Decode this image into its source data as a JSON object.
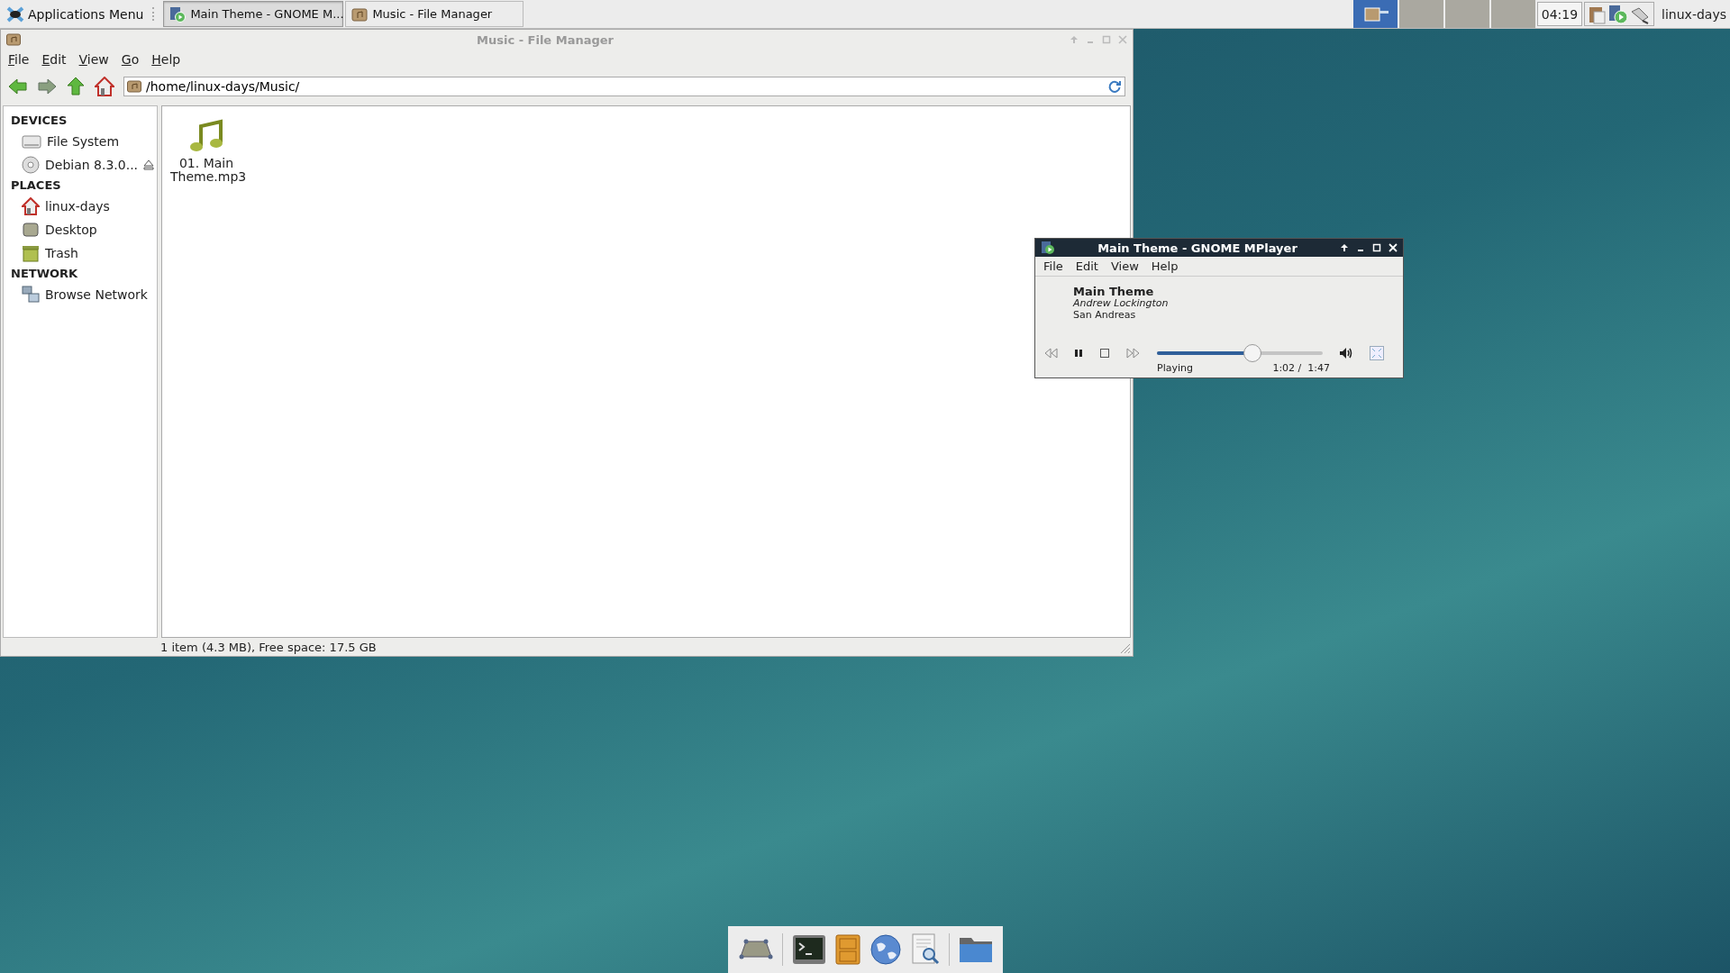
{
  "panel": {
    "apps_menu": "Applications Menu",
    "tasks": [
      {
        "label": "Main Theme - GNOME M...",
        "kind": "player",
        "selected": true
      },
      {
        "label": "Music - File Manager",
        "kind": "folder",
        "selected": false
      }
    ],
    "workspaces": [
      {
        "selected": true
      },
      {
        "selected": false
      },
      {
        "selected": false
      },
      {
        "selected": false
      }
    ],
    "clock": "04:19",
    "tray": [
      {
        "kind": "clipboard"
      },
      {
        "kind": "player"
      },
      {
        "kind": "network"
      }
    ],
    "user": "linux-days"
  },
  "file_manager": {
    "title": "Music - File Manager",
    "menu": [
      "File",
      "Edit",
      "View",
      "Go",
      "Help"
    ],
    "location": "/home/linux-days/Music/",
    "sidebar": [
      {
        "heading": "DEVICES",
        "items": [
          {
            "label": "File System",
            "kind": "drive",
            "eject": false
          },
          {
            "label": "Debian 8.3.0...",
            "kind": "disc",
            "eject": true
          }
        ]
      },
      {
        "heading": "PLACES",
        "items": [
          {
            "label": "linux-days",
            "kind": "home",
            "eject": false
          },
          {
            "label": "Desktop",
            "kind": "desktop",
            "eject": false
          },
          {
            "label": "Trash",
            "kind": "trash",
            "eject": false
          }
        ]
      },
      {
        "heading": "NETWORK",
        "items": [
          {
            "label": "Browse Network",
            "kind": "network",
            "eject": false
          }
        ]
      }
    ],
    "files": [
      {
        "name": "01. Main Theme.mp3",
        "kind": "audio"
      }
    ],
    "status": "1 item (4.3 MB), Free space: 17.5 GB"
  },
  "player": {
    "title": "Main Theme - GNOME MPlayer",
    "menu": [
      "File",
      "Edit",
      "View",
      "Help"
    ],
    "track": "Main Theme",
    "artist": "Andrew Lockington",
    "album": "San Andreas",
    "level": 0.57,
    "state": "Playing",
    "time": "1:02 /  1:47"
  },
  "dock": [
    {
      "kind": "desktop"
    },
    {
      "kind": "separator"
    },
    {
      "kind": "terminal"
    },
    {
      "kind": "cabinet"
    },
    {
      "kind": "globe"
    },
    {
      "kind": "search"
    },
    {
      "kind": "separator"
    },
    {
      "kind": "folder"
    }
  ]
}
